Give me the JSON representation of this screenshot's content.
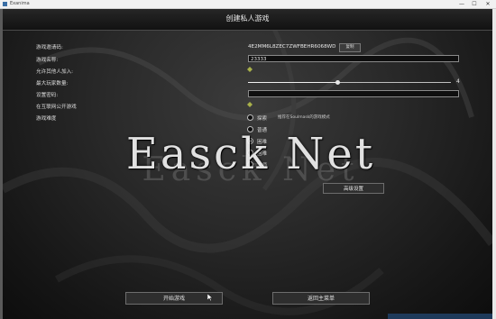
{
  "window": {
    "title": "Exanima",
    "minimize": "—",
    "maximize": "☐",
    "close": "✕"
  },
  "page": {
    "title": "创建私人游戏"
  },
  "form": {
    "invite_code_label": "游戏邀请码:",
    "invite_code_value": "4E2MM6L8ZEC7ZWFBEHR6068WD",
    "copy_label": "复制",
    "game_name_label": "游戏名称:",
    "game_name_value": "23333",
    "allow_join_label": "允许其他人加入:",
    "max_players_label": "最大玩家数量:",
    "max_players_value": "4",
    "max_players_fraction": 0.44,
    "password_label": "设置密码:",
    "password_value": "",
    "public_label": "在互联网公开游戏",
    "difficulty_label": "游戏难度",
    "difficulty_options": [
      "探索",
      "普通",
      "困难",
      "困难",
      "大师"
    ],
    "difficulty_selected_index": 2,
    "difficulty_hint": "推荐在Soulmask的游戏模式",
    "advanced_button": "高级设置"
  },
  "buttons": {
    "start": "开始游戏",
    "back": "返回主菜单"
  },
  "watermark": {
    "text": "Easck Net",
    "ghost": "Easck Net"
  },
  "icons": {
    "checkbox": "diamond-check-icon",
    "cursor": "mouse-pointer-icon"
  },
  "colors": {
    "text": "#dcdcdc",
    "panel": "#2e2e2e",
    "checkbox": "#a8b04a"
  }
}
